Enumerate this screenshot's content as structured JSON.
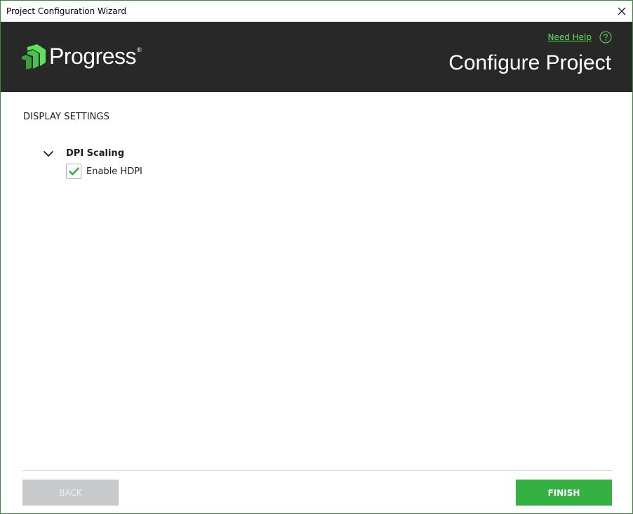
{
  "window": {
    "title": "Project Configuration Wizard"
  },
  "header": {
    "logo_text": "Progress",
    "logo_registered": "®",
    "need_help": "Need Help",
    "title": "Configure Project"
  },
  "content": {
    "section_title": "DISPLAY SETTINGS",
    "groups": [
      {
        "title": "DPI Scaling",
        "expanded": true,
        "options": [
          {
            "label": "Enable HDPI",
            "checked": true
          }
        ]
      }
    ]
  },
  "footer": {
    "back_label": "BACK",
    "back_enabled": false,
    "finish_label": "FINISH"
  },
  "colors": {
    "accent_green": "#5ce35c",
    "finish_green": "#35b144",
    "header_bg": "#282828",
    "disabled_button": "#c7c9cb"
  },
  "icons": {
    "close": "close-icon",
    "help": "question-circle-icon",
    "logo": "progress-logo-icon",
    "chevron": "chevron-down-icon",
    "check": "checkmark-icon"
  }
}
